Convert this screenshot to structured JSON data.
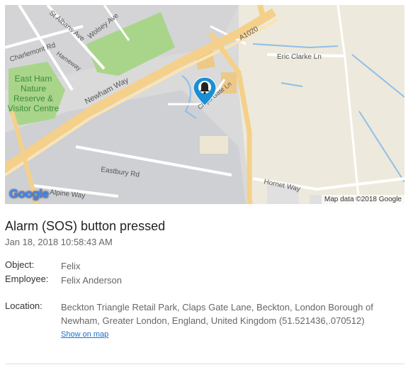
{
  "map": {
    "labels": {
      "st_albans": "St Albans Ave",
      "wolsey": "Wolsey Ave",
      "charlemont": "Charlemont Rd",
      "hameway": "Hameway",
      "a1020": "A1020",
      "eric_clarke": "Eric Clarke Ln",
      "newham_way": "Newham Way",
      "claps_gate": "Claps Gate Ln",
      "eastbury": "Eastbury Rd",
      "alpine": "Alpine Way",
      "hornet": "Hornet Way",
      "poi": [
        "East Ham",
        "Nature",
        "Reserve &",
        "Visitor Centre"
      ]
    },
    "logo": "Google",
    "attribution": "Map data ©2018 Google",
    "pin_icon": "bell-icon",
    "colors": {
      "marker": "#1b8fd3",
      "major_road": "#f7d38a",
      "park": "#a9d58a",
      "water": "#8fbfe8"
    }
  },
  "event": {
    "title": "Alarm (SOS) button pressed",
    "timestamp": "Jan 18, 2018 10:58:43 AM"
  },
  "details": {
    "object_label": "Object:",
    "object_value": "Felix",
    "employee_label": "Employee:",
    "employee_value": "Felix Anderson",
    "location_label": "Location:",
    "location_line1": "Beckton Triangle Retail Park, Claps Gate Lane, Beckton, London Borough of",
    "location_line2": "Newham, Greater London, England, United Kingdom (51.521436,.070512)",
    "show_on_map": "Show on map"
  }
}
